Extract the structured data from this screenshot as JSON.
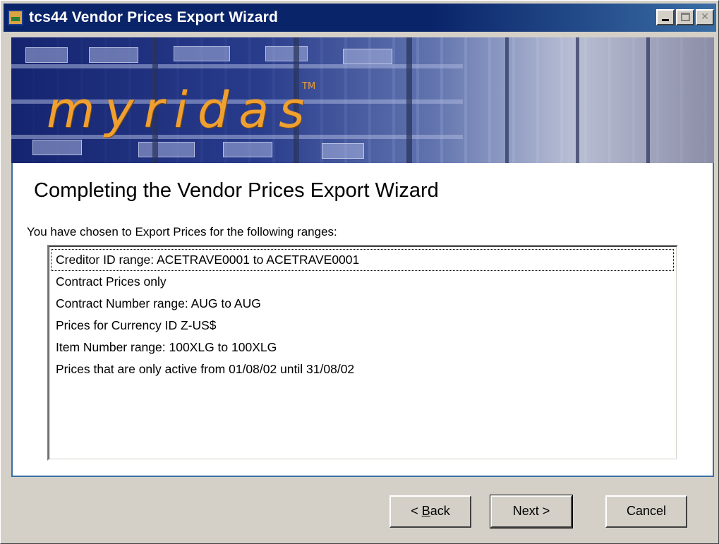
{
  "window": {
    "title": "tcs44 Vendor Prices Export Wizard",
    "title_icon": "app-icon",
    "controls": {
      "minimize": "minimize-icon",
      "maximize": "maximize-icon",
      "close": "close-icon"
    }
  },
  "banner": {
    "logo_text": "myridas",
    "logo_tm": "TM",
    "logo_color": "#f0a030"
  },
  "page": {
    "heading": "Completing the Vendor Prices Export Wizard",
    "intro": "You have chosen to Export Prices for the following ranges:",
    "summary_items": [
      "Creditor ID range: ACETRAVE0001 to ACETRAVE0001",
      "Contract Prices only",
      "Contract Number range: AUG to AUG",
      "Prices for Currency ID Z-US$",
      "Item Number range: 100XLG to 100XLG",
      "Prices that are only active from 01/08/02 until 31/08/02"
    ]
  },
  "buttons": {
    "back_prefix": "< ",
    "back_mnemonic": "B",
    "back_rest": "ack",
    "next": "Next >",
    "cancel": "Cancel"
  },
  "colors": {
    "title_bar": "#0a246a",
    "dialog_face": "#d4d0c8",
    "content_border": "#3a6ea5"
  }
}
